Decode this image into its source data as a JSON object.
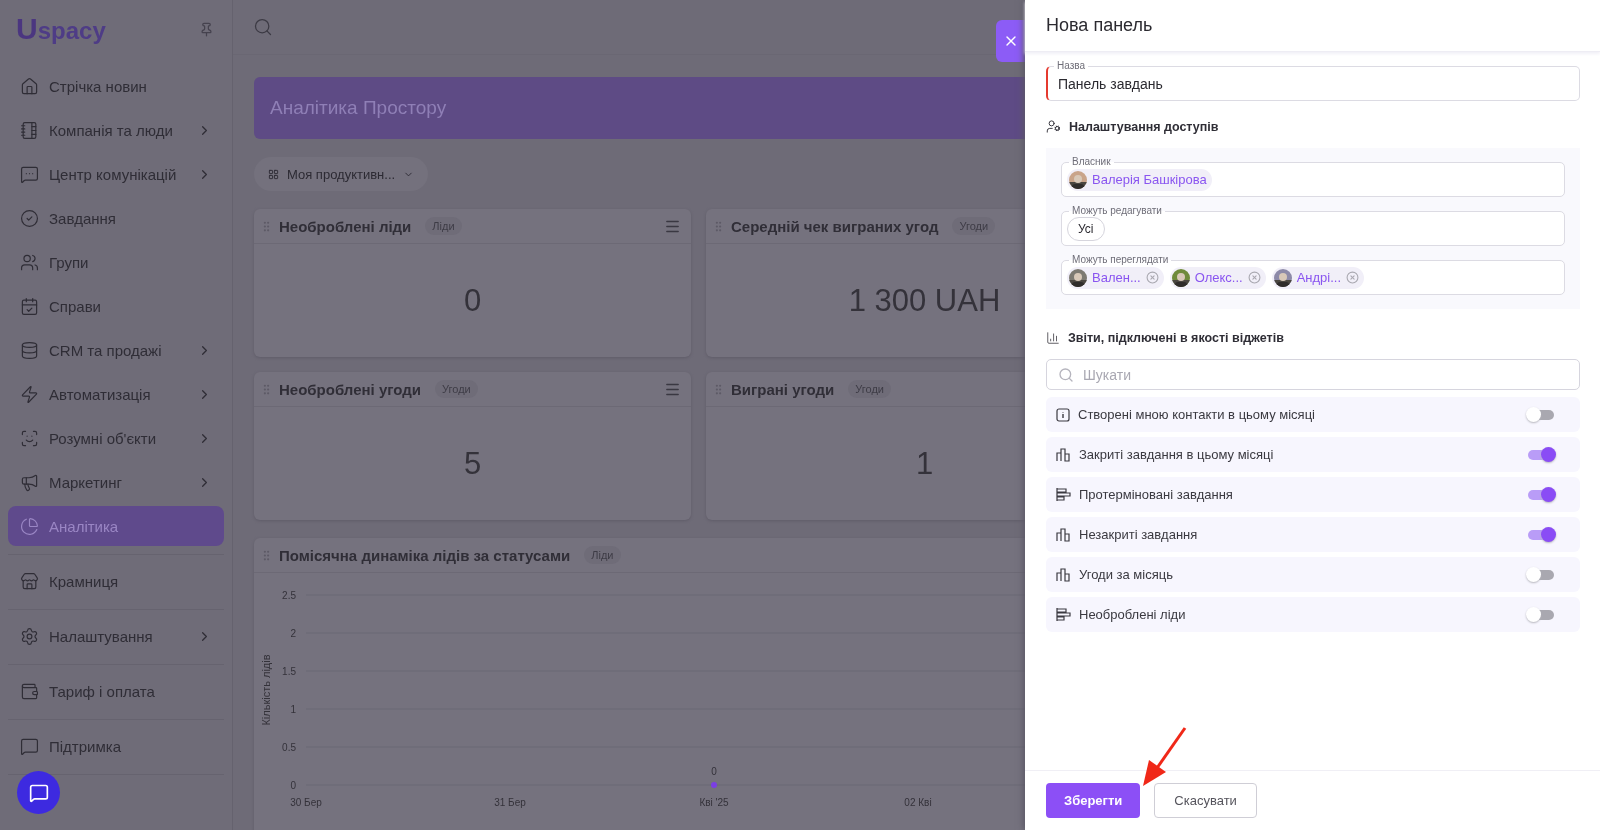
{
  "sidebar": {
    "logo": {
      "mark": "U",
      "text": "spacy"
    },
    "sections": [
      [
        {
          "label": "Стрічка новин",
          "kind": "news",
          "expandable": false,
          "selected": false
        },
        {
          "label": "Компанія та люди",
          "kind": "company",
          "expandable": true,
          "selected": false
        },
        {
          "label": "Центр комунікацій",
          "kind": "comms",
          "expandable": true,
          "selected": false
        },
        {
          "label": "Завдання",
          "kind": "tasks",
          "expandable": false,
          "selected": false
        },
        {
          "label": "Групи",
          "kind": "groups",
          "expandable": false,
          "selected": false
        },
        {
          "label": "Справи",
          "kind": "calendar",
          "expandable": false,
          "selected": false
        },
        {
          "label": "CRM та продажі",
          "kind": "crm",
          "expandable": true,
          "selected": false
        },
        {
          "label": "Автоматизація",
          "kind": "automation",
          "expandable": true,
          "selected": false
        },
        {
          "label": "Розумні об'єкти",
          "kind": "smart",
          "expandable": true,
          "selected": false
        },
        {
          "label": "Маркетинг",
          "kind": "marketing",
          "expandable": true,
          "selected": false
        },
        {
          "label": "Аналітика",
          "kind": "analytics",
          "expandable": false,
          "selected": true
        }
      ],
      [
        {
          "label": "Крамниця",
          "kind": "store",
          "expandable": false,
          "selected": false
        }
      ],
      [
        {
          "label": "Налаштування",
          "kind": "settings",
          "expandable": true,
          "selected": false
        }
      ],
      [
        {
          "label": "Тариф і оплата",
          "kind": "billing",
          "expandable": false,
          "selected": false
        }
      ],
      [
        {
          "label": "Підтримка",
          "kind": "support",
          "expandable": false,
          "selected": false
        }
      ]
    ]
  },
  "banner": {
    "title": "Аналітика Простору"
  },
  "dashboard_select": {
    "value": "Моя продуктивн..."
  },
  "widgets": [
    {
      "title": "Необроблені ліди",
      "tag": "Ліди",
      "value": "0"
    },
    {
      "title": "Середній чек виграних угод",
      "tag": "Угоди",
      "value": "1 300 UAH"
    },
    {
      "title": "Необроблені угоди",
      "tag": "Угоди",
      "value": "5"
    },
    {
      "title": "Виграні угоди",
      "tag": "Угоди",
      "value": "1"
    }
  ],
  "chart_widget": {
    "title": "Помісячна динаміка лідів за статусами",
    "tag": "Ліди",
    "chart_data": {
      "type": "line",
      "ylabel": "Кількість лідів",
      "categories": [
        "30 Бер",
        "31 Бер",
        "Кві '25",
        "02 Кві"
      ],
      "series": [
        {
          "color": "#7b3fe4",
          "marker": "circle",
          "values": [
            null,
            null,
            0,
            null
          ]
        }
      ],
      "ylim": [
        0,
        2.5
      ],
      "yticks": [
        0,
        0.5,
        1,
        1.5,
        2,
        2.5
      ],
      "grid": true,
      "data_labels": true
    }
  },
  "drawer": {
    "title": "Нова панель",
    "name_field": {
      "label": "Назва",
      "value": "Панель завдань"
    },
    "access": {
      "title": "Налаштування доступів",
      "owner": {
        "label": "Власник",
        "chips": [
          {
            "label": "Валерія Башкірова"
          }
        ]
      },
      "editors": {
        "label": "Можуть редагувати",
        "chips": [
          {
            "label": "Усі"
          }
        ]
      },
      "viewers": {
        "label": "Можуть переглядати",
        "chips": [
          {
            "label": "Вален...",
            "removable": true
          },
          {
            "label": "Олекс...",
            "removable": true
          },
          {
            "label": "Андрі...",
            "removable": true
          }
        ]
      }
    },
    "reports": {
      "title": "Звіти, підключені в якості віджетів",
      "search_placeholder": "Шукати",
      "items": [
        {
          "label": "Створені мною контакти в цьому місяці",
          "kind": "counter",
          "on": false
        },
        {
          "label": "Закриті завдання в цьому місяці",
          "kind": "columns",
          "on": true
        },
        {
          "label": "Протерміновані завдання",
          "kind": "bars",
          "on": true
        },
        {
          "label": "Незакриті завдання",
          "kind": "columns",
          "on": true
        },
        {
          "label": "Угоди за місяць",
          "kind": "columns",
          "on": false
        },
        {
          "label": "Необроблені ліди",
          "kind": "bars",
          "on": false
        }
      ]
    },
    "buttons": [
      {
        "label": "Зберегти",
        "kind": "primary"
      },
      {
        "label": "Скасувати",
        "kind": "secondary"
      }
    ]
  }
}
